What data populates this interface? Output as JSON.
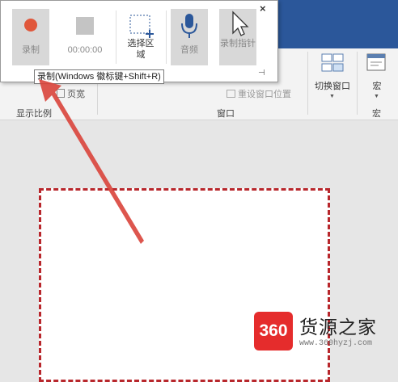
{
  "toolbar": {
    "record_label": "录制",
    "time_label": "00:00:00",
    "select_area_label": "选择区域",
    "audio_label": "音频",
    "record_pointer_label": "录制指针",
    "close": "×",
    "pin": "⊣",
    "tooltip": "录制(Windows 徽标键+Shift+R)"
  },
  "ribbon": {
    "zoom_group_label": "显示比例",
    "fit_width": "页宽",
    "reset_window_position": "重设窗口位置",
    "window_group_label": "窗口",
    "switch_window": "切换窗口",
    "macro": "宏",
    "macro_group_label": "宏"
  },
  "watermark": {
    "badge": "360",
    "brand": "货源之家",
    "url": "www.360hyzj.com"
  },
  "colors": {
    "record_dot": "#e0573b",
    "slide_border": "#b8272c",
    "arrow": "#d9443b",
    "title_bar": "#2b579a"
  }
}
